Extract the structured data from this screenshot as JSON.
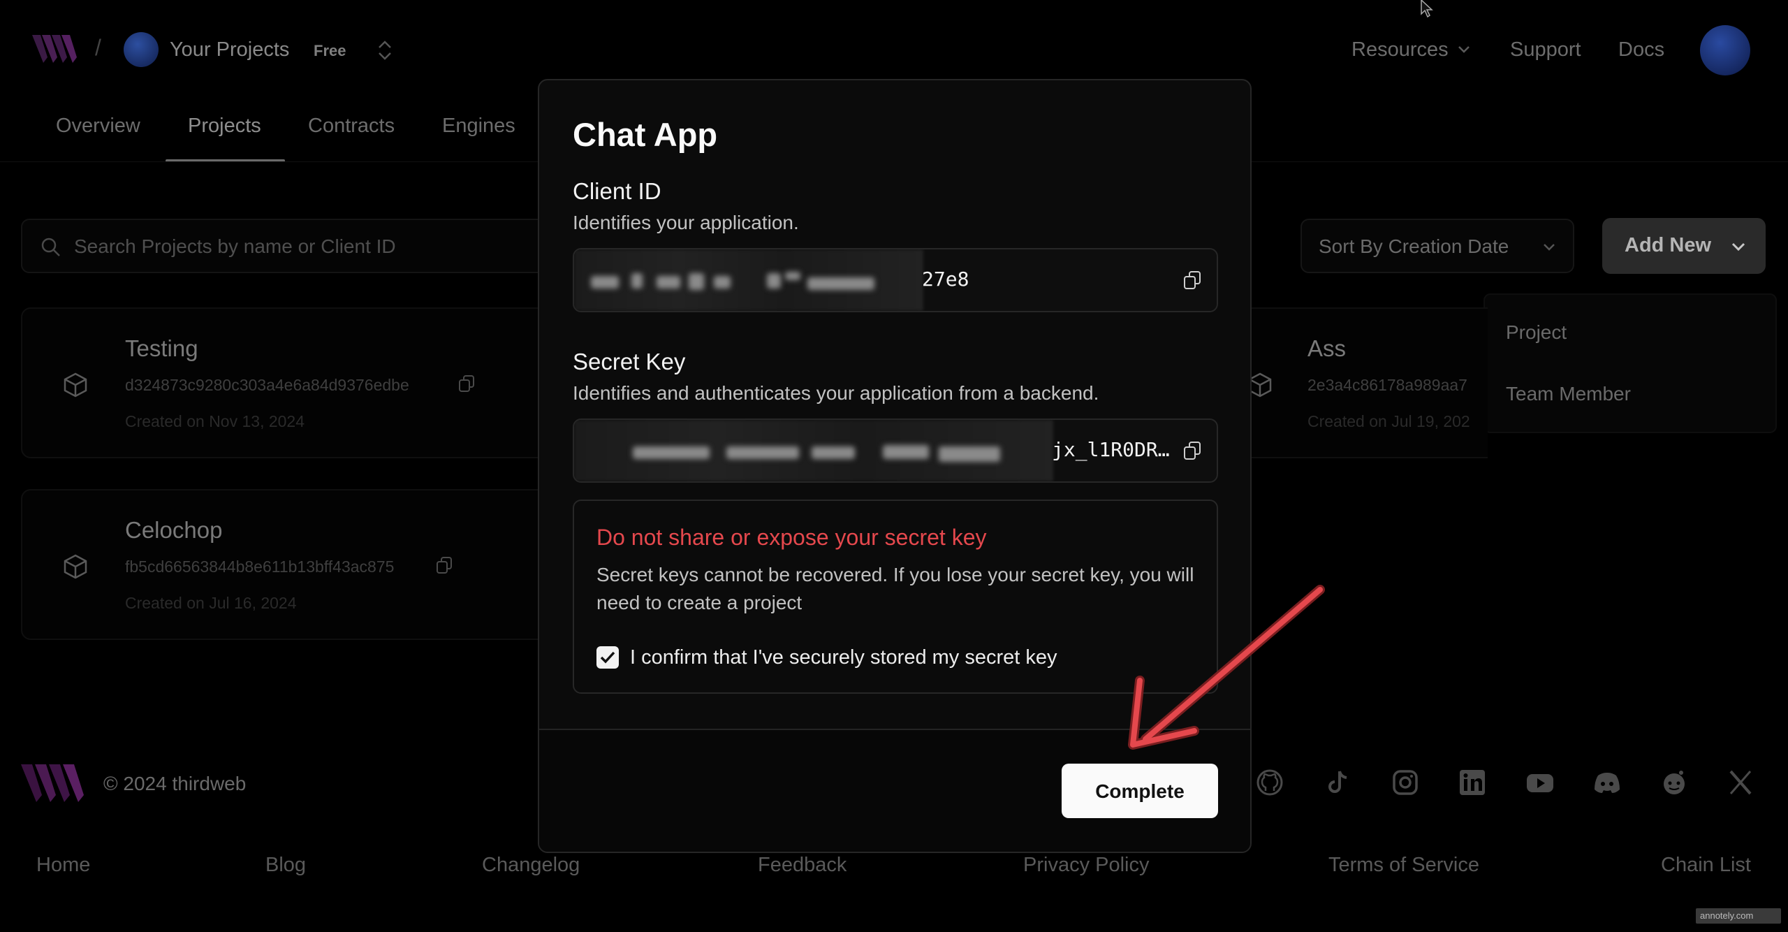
{
  "header": {
    "breadcrumb_separator": "/",
    "workspace_title": "Your Projects",
    "plan_badge": "Free",
    "nav": [
      "Resources",
      "Support",
      "Docs"
    ]
  },
  "tabs": [
    "Overview",
    "Projects",
    "Contracts",
    "Engines"
  ],
  "active_tab": "Projects",
  "search": {
    "placeholder": "Search Projects by name or Client ID"
  },
  "sort": {
    "label": "Sort By Creation Date"
  },
  "add_new": {
    "label": "Add New",
    "menu": [
      "Project",
      "Team Member"
    ]
  },
  "projects": [
    {
      "name": "Testing",
      "client_id": "d324873c9280c303a4e6a84d9376edbe",
      "created": "Created on Nov 13, 2024"
    },
    {
      "name": "Celochop",
      "client_id": "fb5cd66563844b8e611b13bff43ac875",
      "created": "Created on Jul 16, 2024"
    },
    {
      "name": "Ass",
      "client_id": "2e3a4c86178a989aa7",
      "created": "Created on Jul 19, 202"
    }
  ],
  "footer": {
    "copyright": "© 2024 thirdweb",
    "links": [
      "Home",
      "Blog",
      "Changelog",
      "Feedback",
      "Privacy Policy",
      "Terms of Service",
      "Chain List"
    ],
    "social_icons": [
      "github-icon",
      "tiktok-icon",
      "instagram-icon",
      "linkedin-icon",
      "youtube-icon",
      "discord-icon",
      "reddit-icon",
      "x-icon"
    ]
  },
  "modal": {
    "title": "Chat App",
    "client_id": {
      "label": "Client ID",
      "description": "Identifies your application.",
      "value_visible": "27e8"
    },
    "secret_key": {
      "label": "Secret Key",
      "description": "Identifies and authenticates your application from a backend.",
      "value_visible": "jx_l1R0DR…"
    },
    "warning": {
      "title": "Do not share or expose your secret key",
      "text": "Secret keys cannot be recovered. If you lose your secret key, you will need to create a project",
      "confirm_label": "I confirm that I've securely stored my secret key",
      "confirmed": true
    },
    "complete_label": "Complete"
  },
  "annotation": {
    "arrow_color": "#e5484d"
  },
  "watermark": "annotely.com",
  "colors": {
    "warning": "#e5484d",
    "modal_bg": "#0b0b0b",
    "primary_button": "#fafafa"
  }
}
